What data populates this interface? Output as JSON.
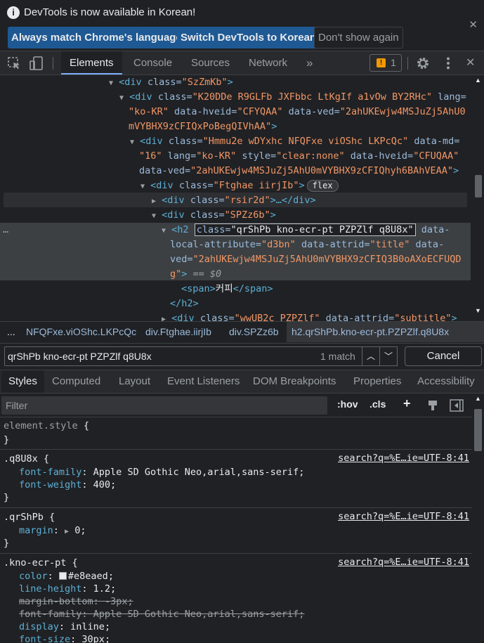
{
  "infobar": {
    "icon": "info-icon",
    "message": "DevTools is now available in Korean!",
    "buttons": [
      "Always match Chrome's language",
      "Switch DevTools to Korean",
      "Don't show again"
    ]
  },
  "toolbar": {
    "tabs": [
      "Elements",
      "Console",
      "Sources",
      "Network"
    ],
    "more": "»",
    "issues_count": "1",
    "issues_icon": "!"
  },
  "dom": {
    "lines": [
      {
        "tag": "<div",
        "a1": " class=",
        "v1": "\"SzZmKb\"",
        "end": ">"
      },
      {
        "tag": "<div",
        "a1": " class=",
        "v1": "\"K20DDe R9GLFb JXFbbc LtKgIf a1vOw BY2RHc\"",
        "a2": " lang=",
        "v2": ""
      },
      {
        "v1": "\"ko-KR\"",
        "a2": " data-hveid=",
        "v2": "\"CFYQAA\"",
        "a3": " data-ved=",
        "v3": "\"2ahUKEwjw4MSJuZj5AhU0"
      },
      {
        "v1": "mVYBHX9zCFIQxPoBegQIVhAA\"",
        "end": ">"
      },
      {
        "tag": "<div",
        "a1": " class=",
        "v1": "\"Hmmu2e wDYxhc NFQFxe viOShc LKPcQc\"",
        "a2": " data-md=",
        "v2": ""
      },
      {
        "v1": "\"16\"",
        "a2": " lang=",
        "v2": "\"ko-KR\"",
        "a3": " style=",
        "v3": "\"clear:none\"",
        "a4": " data-hveid=",
        "v4": "\"CFUQAA\""
      },
      {
        "a1": "data-ved=",
        "v1": "\"2ahUKEwjw4MSJuZj5AhU0mVYBHX9zCFIQhyh6BAhVEAA\"",
        "end": ">"
      },
      {
        "tag": "<div",
        "a1": " class=",
        "v1": "\"Ftghae iirjIb\"",
        "end": ">",
        "badge": "flex"
      },
      {
        "tag": "<div",
        "a1": " class=",
        "v1": "\"rsir2d\"",
        "end": ">…</div>"
      },
      {
        "tag": "<div",
        "a1": " class=",
        "v1": "\"SPZz6b\"",
        "end": ">"
      },
      {
        "tag": "<h2",
        "a1": " class=",
        "v1": "\"qrShPb kno-ecr-pt PZPZlf q8U8x\"",
        "a2": " data-"
      },
      {
        "a1": "local-attribute=",
        "v1": "\"d3bn\"",
        "a2": " data-attrid=",
        "v2": "\"title\"",
        "a3": " data-"
      },
      {
        "a1": "ved=",
        "v1": "\"2ahUKEwjw4MSJuZj5AhU0mVYBHX9zCFIQ3B0oAXoECFUQD"
      },
      {
        "v1": "g\"",
        "end": ">",
        "eq": " == $0"
      },
      {
        "tag": "<span",
        "end": ">",
        "text": "커피",
        "close": "</span>"
      },
      {
        "tag": "</h2",
        "end": ">"
      },
      {
        "tag": "<div",
        "a1": " class=",
        "v1": "\"wwUB2c PZPZlf\"",
        "a2": " data-attrid=",
        "v2": "\"subtitle\"",
        "end": ">"
      }
    ]
  },
  "breadcrumbs": {
    "more": "...",
    "items": [
      "NFQFxe.viOShc.LKPcQc",
      "div.Ftghae.iirjIb",
      "div.SPZz6b",
      "h2.qrShPb.kno-ecr-pt.PZPZlf.q8U8x"
    ]
  },
  "search": {
    "value": "qrShPb kno-ecr-pt PZPZlf q8U8x",
    "match": "1 match",
    "cancel": "Cancel"
  },
  "subtabs": [
    "Styles",
    "Computed",
    "Layout",
    "Event Listeners",
    "DOM Breakpoints",
    "Properties",
    "Accessibility"
  ],
  "filter": {
    "placeholder": "Filter",
    "hov": ":hov",
    "cls": ".cls",
    "plus": "+"
  },
  "styles": {
    "rules": [
      {
        "selector": "element.style",
        "source": "",
        "props": []
      },
      {
        "selector": ".q8U8x",
        "source": "search?q=%E…ie=UTF-8:41",
        "props": [
          {
            "name": "font-family",
            "value": "Apple SD Gothic Neo,arial,sans-serif",
            "struck": false
          },
          {
            "name": "font-weight",
            "value": "400",
            "struck": false
          }
        ]
      },
      {
        "selector": ".qrShPb",
        "source": "search?q=%E…ie=UTF-8:41",
        "props": [
          {
            "name": "margin",
            "value": "0",
            "struck": false,
            "arrow": true
          }
        ]
      },
      {
        "selector": ".kno-ecr-pt",
        "source": "search?q=%E…ie=UTF-8:41",
        "props": [
          {
            "name": "color",
            "value": "#e8eaed",
            "struck": false,
            "swatch": "#e8eaed"
          },
          {
            "name": "line-height",
            "value": "1.2",
            "struck": false
          },
          {
            "name": "margin-bottom",
            "value": "-3px",
            "struck": true
          },
          {
            "name": "font-family",
            "value": "Apple SD Gothic Neo,arial,sans-serif",
            "struck": true
          },
          {
            "name": "display",
            "value": "inline",
            "struck": false
          },
          {
            "name": "font-size",
            "value": "30px",
            "struck": false
          }
        ]
      }
    ]
  }
}
